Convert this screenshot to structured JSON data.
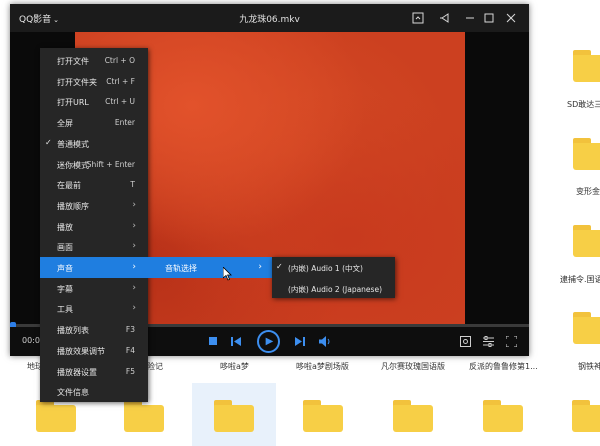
{
  "player": {
    "app_menu": "QQ影音",
    "file_title": "九龙珠06.mkv",
    "time": "00:0",
    "titlebar_icons": [
      "screenshot-icon",
      "pin-icon",
      "minimize-icon",
      "maximize-icon",
      "close-icon"
    ],
    "controls": {
      "left": [
        "stop-icon",
        "previous-icon",
        "play-icon",
        "next-icon",
        "volume-icon"
      ],
      "right": [
        "toolbox-icon",
        "settings-icon",
        "fullscreen-icon"
      ]
    },
    "accent_color": "#1f7ee0"
  },
  "context_menu": {
    "items": [
      {
        "label": "打开文件",
        "shortcut": "Ctrl + O"
      },
      {
        "label": "打开文件夹",
        "shortcut": "Ctrl + F"
      },
      {
        "label": "打开URL",
        "shortcut": "Ctrl + U"
      },
      {
        "label": "全屏",
        "shortcut": "Enter"
      },
      {
        "label": "普通模式",
        "checked": true
      },
      {
        "label": "迷你模式",
        "shortcut": "Shift + Enter"
      },
      {
        "label": "在最前",
        "shortcut": "T"
      },
      {
        "label": "播放顺序",
        "submenu": true
      },
      {
        "label": "播放",
        "submenu": true
      },
      {
        "label": "画面",
        "submenu": true
      },
      {
        "label": "声音",
        "submenu": true,
        "active": true
      },
      {
        "label": "字幕",
        "submenu": true
      },
      {
        "label": "工具",
        "submenu": true
      },
      {
        "label": "播放列表",
        "shortcut": "F3"
      },
      {
        "label": "播放效果调节",
        "shortcut": "F4"
      },
      {
        "label": "播放器设置",
        "shortcut": "F5"
      },
      {
        "label": "文件信息"
      }
    ]
  },
  "sound_submenu": {
    "label": "音轨选择"
  },
  "audio_track_submenu": {
    "items": [
      {
        "label": "(内嵌) Audio 1 (中文)",
        "checked": true
      },
      {
        "label": "(内嵌) Audio 2 (Japanese)",
        "checked": false
      }
    ]
  },
  "desktop": {
    "file_labels": {
      "sd_label": "SD敢达三",
      "bianxing": "变形金",
      "daibuling": "逮捕令.国语",
      "ganglie": "钢铁神",
      "diqiu": "地球",
      "xianji": "险记",
      "douala": "哆啦a梦",
      "douala_theater": "哆啦a梦剧场版",
      "fanersai": "凡尔赛玫瑰国语版",
      "fanpai": "反派的鲁鲁修第1..."
    }
  }
}
